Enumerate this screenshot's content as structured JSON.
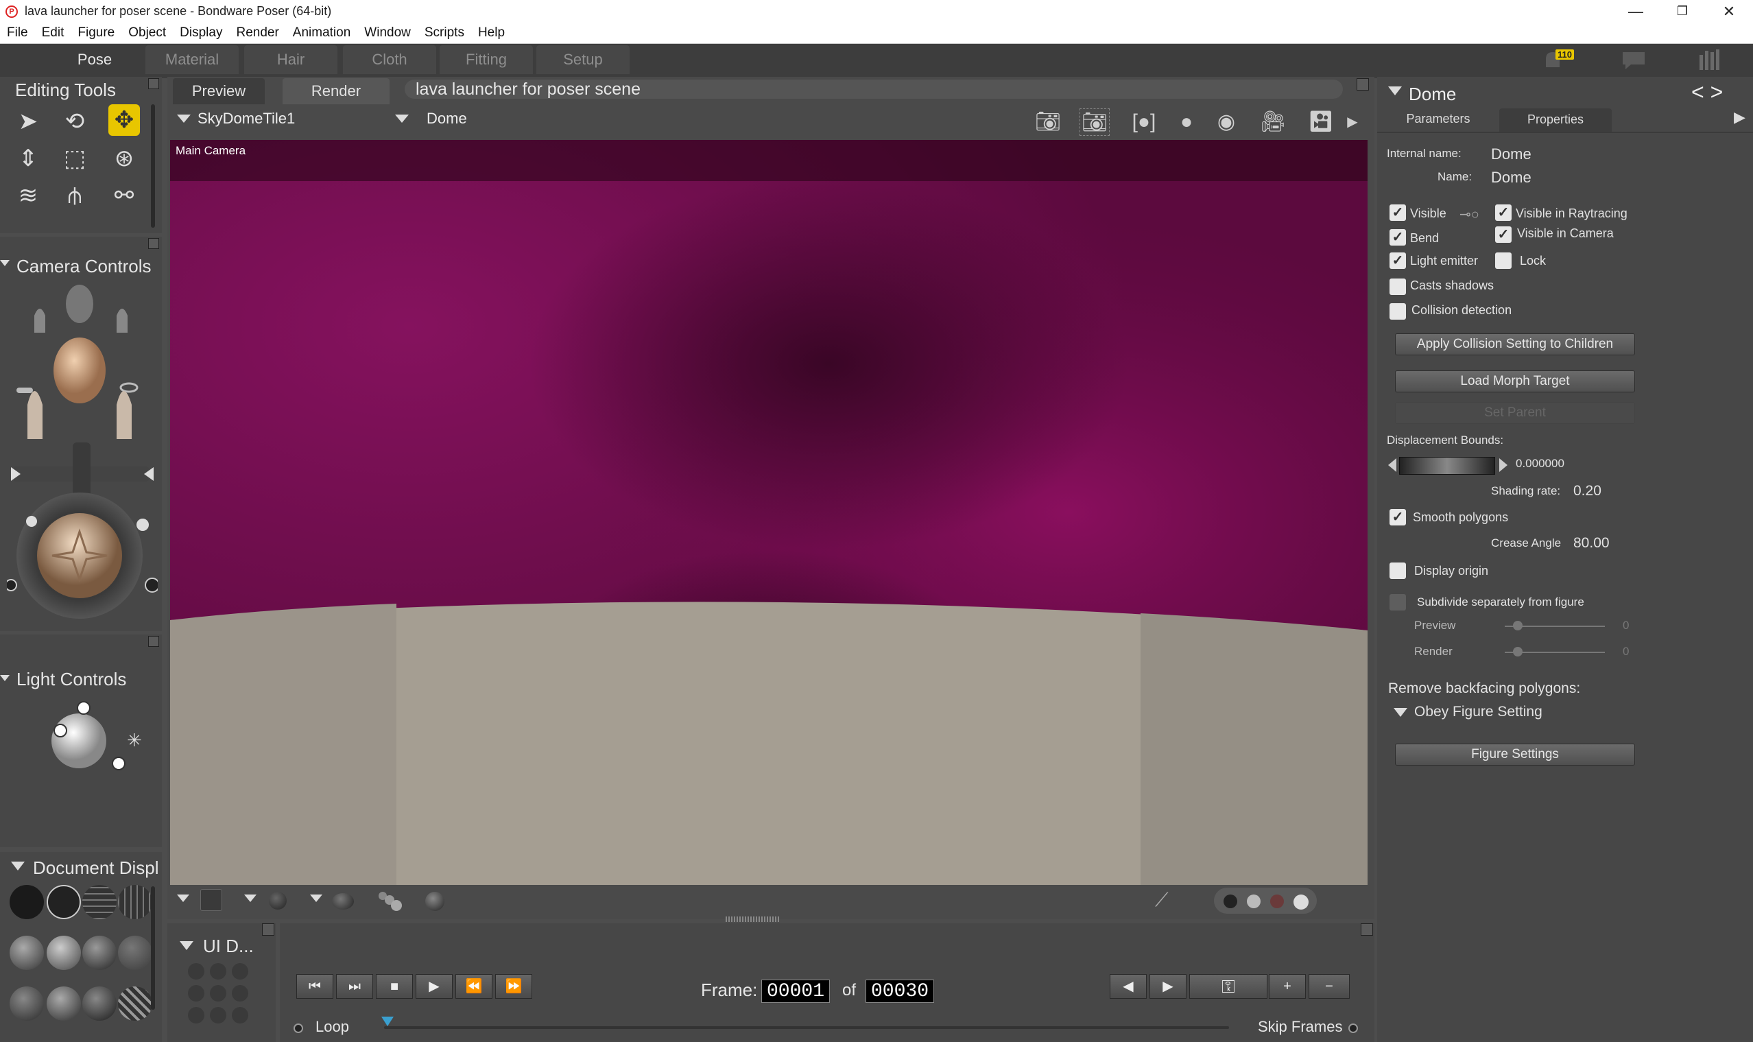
{
  "window": {
    "title": "lava launcher for poser scene - Bondware Poser (64-bit)",
    "minimize": "—",
    "restore": "❐",
    "close": "✕"
  },
  "menu": [
    "File",
    "Edit",
    "Figure",
    "Object",
    "Display",
    "Render",
    "Animation",
    "Window",
    "Scripts",
    "Help"
  ],
  "rooms": [
    "Pose",
    "Material",
    "Hair",
    "Cloth",
    "Fitting",
    "Setup"
  ],
  "notifications": {
    "count": "110"
  },
  "editing_tools": {
    "title": "Editing Tools"
  },
  "camera_controls": {
    "title": "Camera Controls"
  },
  "light_controls": {
    "title": "Light Controls"
  },
  "document_display": {
    "title": "Document  Displ"
  },
  "ui_dots": {
    "title": "UI D..."
  },
  "document": {
    "tabs": [
      "Preview",
      "Render"
    ],
    "scene_name": "lava launcher for poser scene",
    "figure_select": "SkyDomeTile1",
    "actor_select": "Dome",
    "camera_label": "Main Camera"
  },
  "properties_panel": {
    "title": "Dome",
    "tabs": [
      "Parameters",
      "Properties"
    ],
    "internal_name_label": "Internal name:",
    "internal_name": "Dome",
    "name_label": "Name:",
    "name": "Dome",
    "checkboxes": {
      "visible": {
        "label": "Visible",
        "checked": true
      },
      "visible_raytracing": {
        "label": "Visible in Raytracing",
        "checked": true
      },
      "bend": {
        "label": "Bend",
        "checked": true
      },
      "visible_camera": {
        "label": "Visible in Camera",
        "checked": true
      },
      "light_emitter": {
        "label": "Light emitter",
        "checked": true
      },
      "lock": {
        "label": "Lock",
        "checked": false
      },
      "casts_shadows": {
        "label": "Casts shadows",
        "checked": false
      },
      "collision_detection": {
        "label": "Collision detection",
        "checked": false
      },
      "smooth_polygons": {
        "label": "Smooth polygons",
        "checked": true
      },
      "display_origin": {
        "label": "Display origin",
        "checked": false
      },
      "subdivide": {
        "label": "Subdivide separately from figure",
        "checked": false
      }
    },
    "apply_collision": "Apply Collision Setting to Children",
    "load_morph": "Load Morph Target",
    "set_parent": "Set Parent",
    "displacement_label": "Displacement Bounds:",
    "displacement_value": "0.000000",
    "shading_rate_label": "Shading rate:",
    "shading_rate": "0.20",
    "crease_angle_label": "Crease Angle",
    "crease_angle": "80.00",
    "preview_label": "Preview",
    "preview_value": "0",
    "render_label": "Render",
    "render_value": "0",
    "backfacing_label": "Remove backfacing polygons:",
    "backfacing_value": "Obey Figure Setting",
    "figure_settings": "Figure Settings"
  },
  "timeline": {
    "frame_label": "Frame:",
    "current_frame": "00001",
    "of_label": "of",
    "total_frames": "00030",
    "loop_label": "Loop",
    "skip_frames_label": "Skip Frames",
    "transport": [
      "⏮",
      "⏭",
      "■",
      "▶",
      "⏪",
      "⏩"
    ],
    "key_buttons": [
      "◀",
      "▶",
      "⚿",
      "+",
      "−"
    ]
  },
  "colors": {
    "sky": "#6a0a4a",
    "ground": "#a59e92",
    "accent_yellow": "#e8c600"
  }
}
